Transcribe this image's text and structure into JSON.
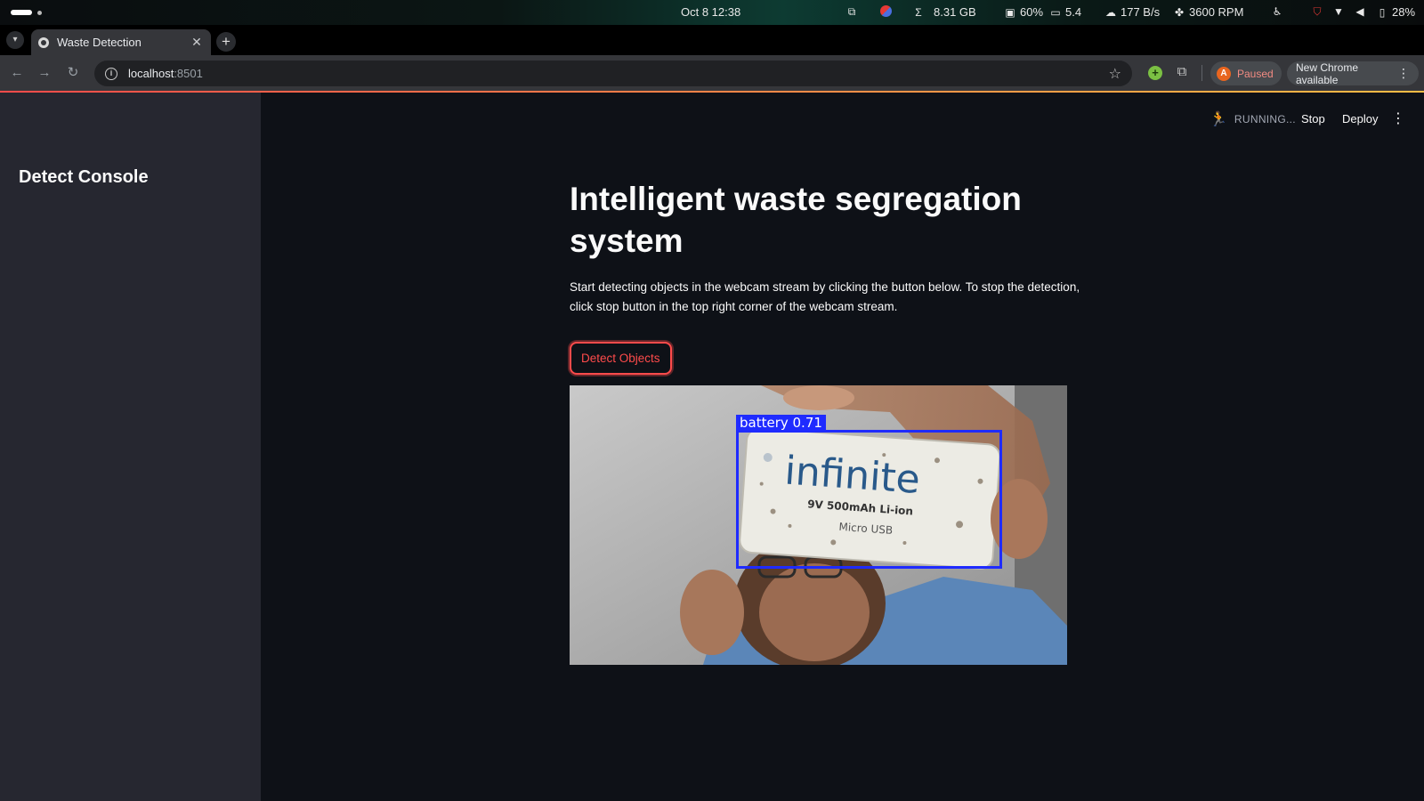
{
  "os": {
    "clock": "Oct 8  12:38",
    "memory": "8.31 GB",
    "cpu": "60%",
    "load": "5.4",
    "network": "177 B/s",
    "fan": "3600 RPM",
    "battery": "28%"
  },
  "browser": {
    "tab_title": "Waste Detection",
    "url_host": "localhost",
    "url_port": ":8501",
    "profile_initial": "A",
    "profile_status": "Paused",
    "update_label": "New Chrome available"
  },
  "app": {
    "sidebar_title": "Detect Console",
    "status_text": "RUNNING...",
    "stop_label": "Stop",
    "deploy_label": "Deploy",
    "page_title": "Intelligent waste segregation system",
    "intro": "Start detecting objects in the webcam stream by clicking the button below. To stop the detection, click stop button in the top right corner of the webcam stream.",
    "detect_button": "Detect Objects",
    "detection": {
      "label": "battery 0.71",
      "object_text": "infinite",
      "object_subtext": "9V 500mAh Li-ion",
      "object_subtext2": "Micro USB"
    }
  },
  "colors": {
    "accent": "#ff4b4b",
    "app_bg": "#0e1117",
    "sidebar_bg": "#262730",
    "detection_box": "#1f2bff"
  },
  "icons": [
    "workspace-indicator-icon",
    "screen-share-icon",
    "chrome-ext-icon",
    "sigma-icon",
    "cpu-icon",
    "monitor-icon",
    "cloud-upload-icon",
    "fan-icon",
    "accessibility-icon",
    "shield-icon",
    "wifi-icon",
    "volume-icon",
    "battery-icon",
    "tab-list-icon",
    "favicon-icon",
    "close-icon",
    "plus-icon",
    "back-icon",
    "forward-icon",
    "reload-icon",
    "info-icon",
    "star-icon",
    "extension-green-icon",
    "puzzle-icon",
    "kebab-icon",
    "runner-icon"
  ]
}
